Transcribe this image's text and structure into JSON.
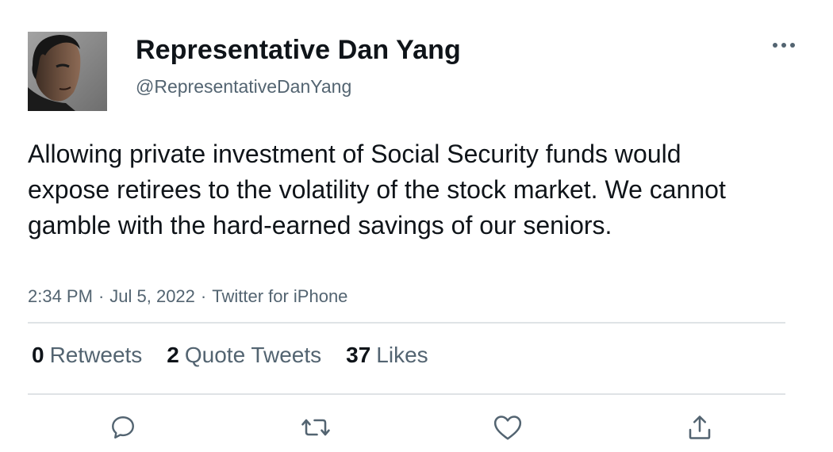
{
  "author": {
    "display_name": "Representative Dan Yang",
    "handle": "@RepresentativeDanYang"
  },
  "tweet": {
    "text": "Allowing private investment of Social Security funds would expose retirees to the volatility of the stock market. We cannot gamble with the hard-earned savings of our seniors.",
    "time": "2:34 PM",
    "date": "Jul 5, 2022",
    "source": "Twitter for iPhone",
    "separator": "·"
  },
  "stats": {
    "retweets": {
      "count": "0",
      "label": "Retweets"
    },
    "quote_tweets": {
      "count": "2",
      "label": "Quote Tweets"
    },
    "likes": {
      "count": "37",
      "label": "Likes"
    }
  },
  "icons": {
    "more": "more-horizontal-icon",
    "reply": "reply-icon",
    "retweet": "retweet-icon",
    "like": "heart-icon",
    "share": "share-icon"
  },
  "colors": {
    "text_primary": "#0f1419",
    "text_secondary": "#536471",
    "icon": "#536471",
    "divider": "#dfe3e6"
  }
}
